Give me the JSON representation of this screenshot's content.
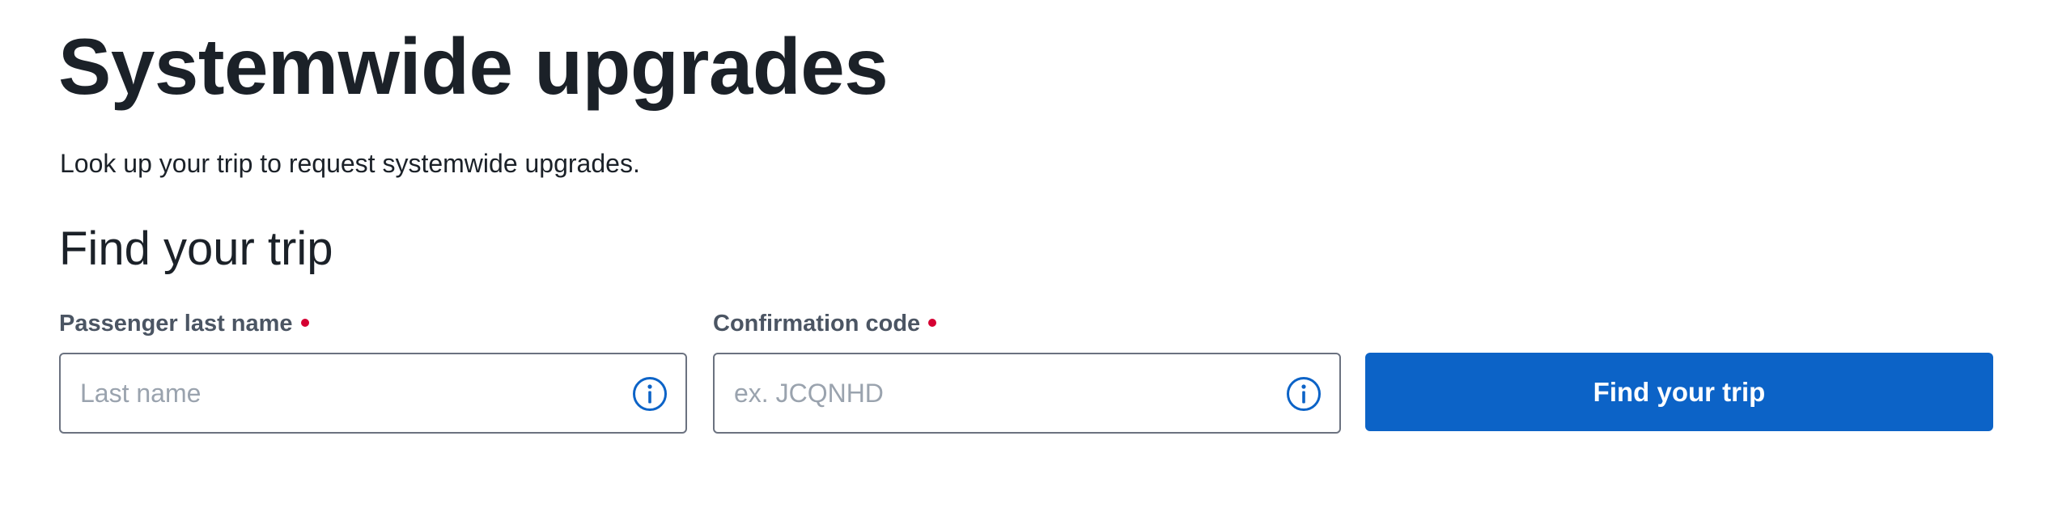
{
  "page": {
    "title": "Systemwide upgrades",
    "intro": "Look up your trip to request systemwide upgrades."
  },
  "form": {
    "section_title": "Find your trip",
    "last_name": {
      "label": "Passenger last name",
      "placeholder": "Last name",
      "value": "",
      "required": true,
      "info_icon": "info-icon"
    },
    "confirmation_code": {
      "label": "Confirmation code",
      "placeholder": "ex. JCQNHD",
      "value": "",
      "required": true,
      "info_icon": "info-icon"
    },
    "submit_label": "Find your trip"
  },
  "colors": {
    "primary_button": "#0c63c7",
    "required_indicator": "#d50032",
    "info_icon": "#0c63c7",
    "text": "#1b2128",
    "label_text": "#4b5563",
    "placeholder_text": "#9aa3ae",
    "input_border": "#6b7280"
  }
}
